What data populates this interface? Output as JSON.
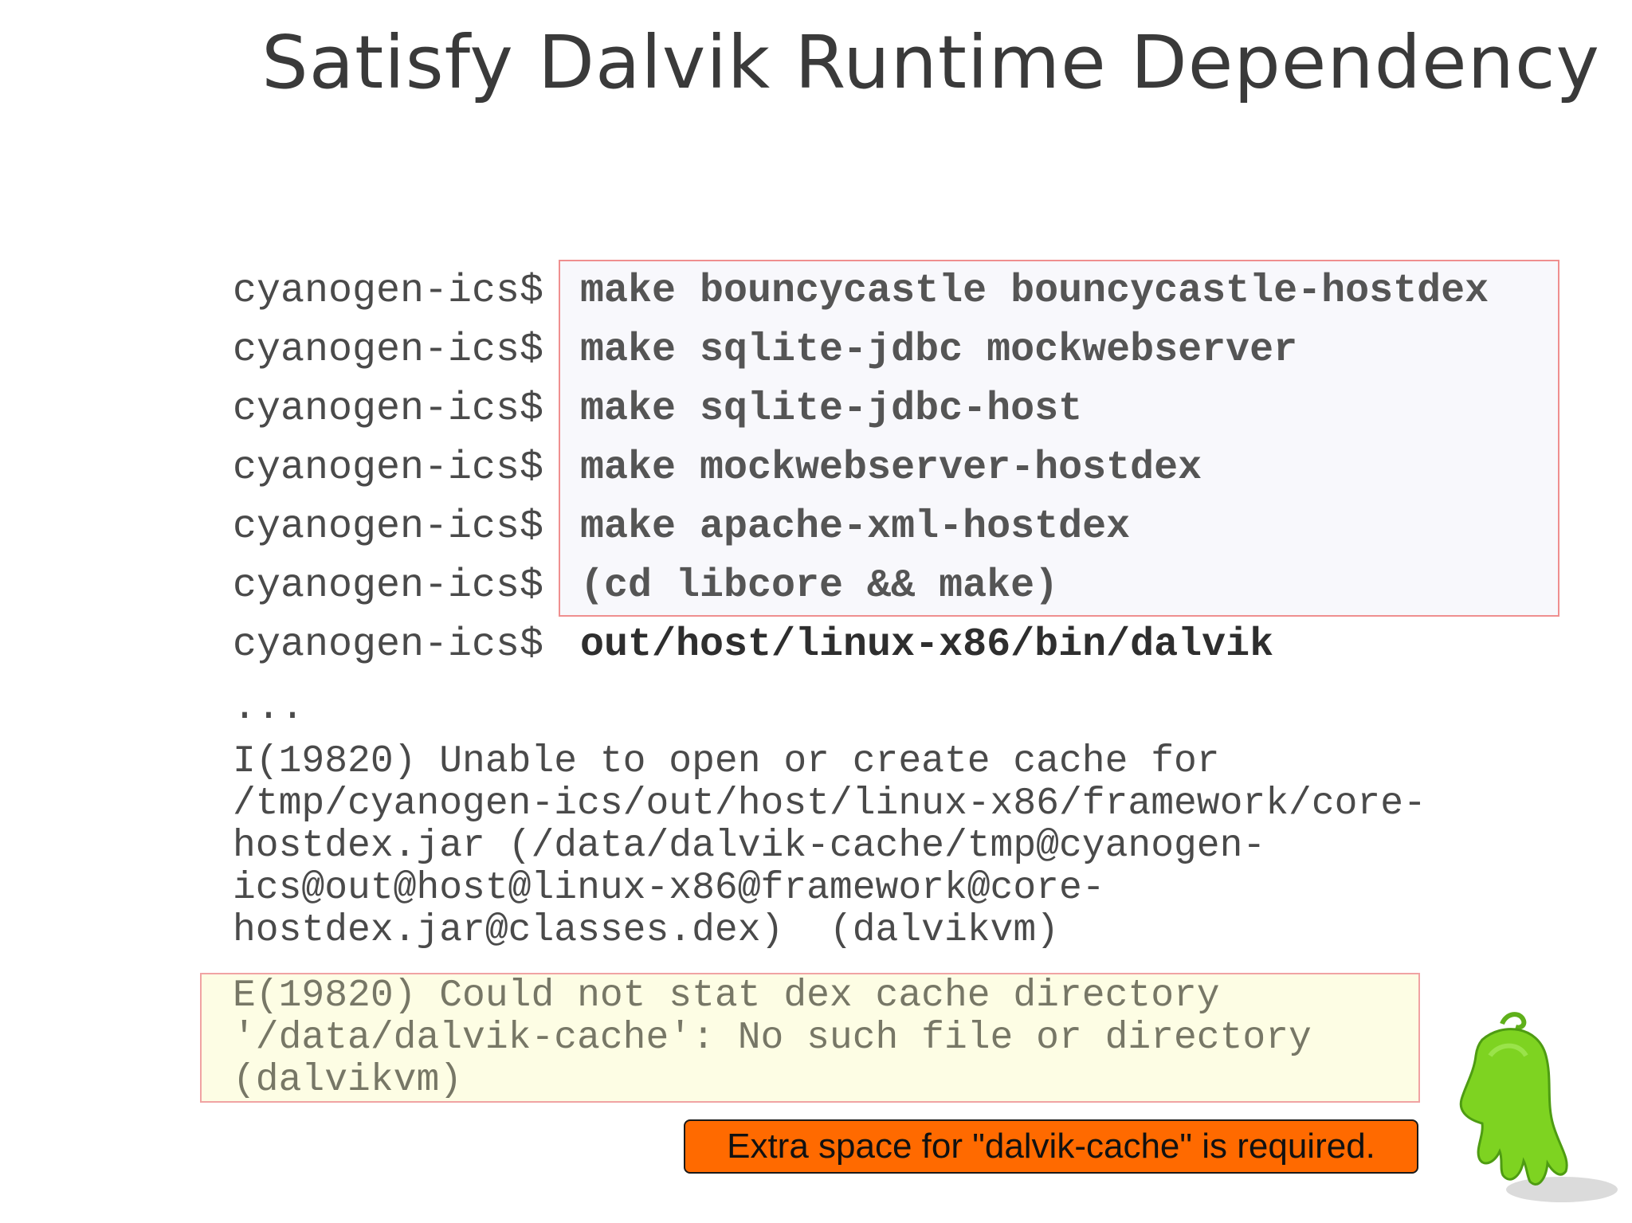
{
  "slide": {
    "title": "Satisfy Dalvik Runtime Dependency"
  },
  "terminal": {
    "lines": [
      {
        "prompt": "cyanogen-ics$",
        "command": "make bouncycastle bouncycastle-hostdex"
      },
      {
        "prompt": "cyanogen-ics$",
        "command": "make sqlite-jdbc mockwebserver"
      },
      {
        "prompt": "cyanogen-ics$",
        "command": "make sqlite-jdbc-host"
      },
      {
        "prompt": "cyanogen-ics$",
        "command": "make mockwebserver-hostdex"
      },
      {
        "prompt": "cyanogen-ics$",
        "command": "make apache-xml-hostdex"
      },
      {
        "prompt": "cyanogen-ics$",
        "command": "(cd libcore && make)"
      },
      {
        "prompt": "cyanogen-ics$",
        "command": "out/host/linux-x86/bin/dalvik"
      }
    ],
    "ellipsis": "...",
    "info_log": [
      "I(19820) Unable to open or create cache for",
      "/tmp/cyanogen-ics/out/host/linux-x86/framework/core-",
      "hostdex.jar (/data/dalvik-cache/tmp@cyanogen-",
      "ics@out@host@linux-x86@framework@core-",
      "hostdex.jar@classes.dex)  (dalvikvm)"
    ],
    "error_log": [
      "E(19820) Could not stat dex cache directory",
      "'/data/dalvik-cache': No such file or directory",
      "(dalvikvm)"
    ]
  },
  "callout": {
    "text": "Extra space for \"dalvik-cache\" is required."
  },
  "colors": {
    "callout_bg": "#ff6a00",
    "error_bg": "#fdfde4",
    "command_box_bg": "#f8f8fc",
    "box_border": "#ef8f8f",
    "mascot_green": "#7ed321"
  }
}
